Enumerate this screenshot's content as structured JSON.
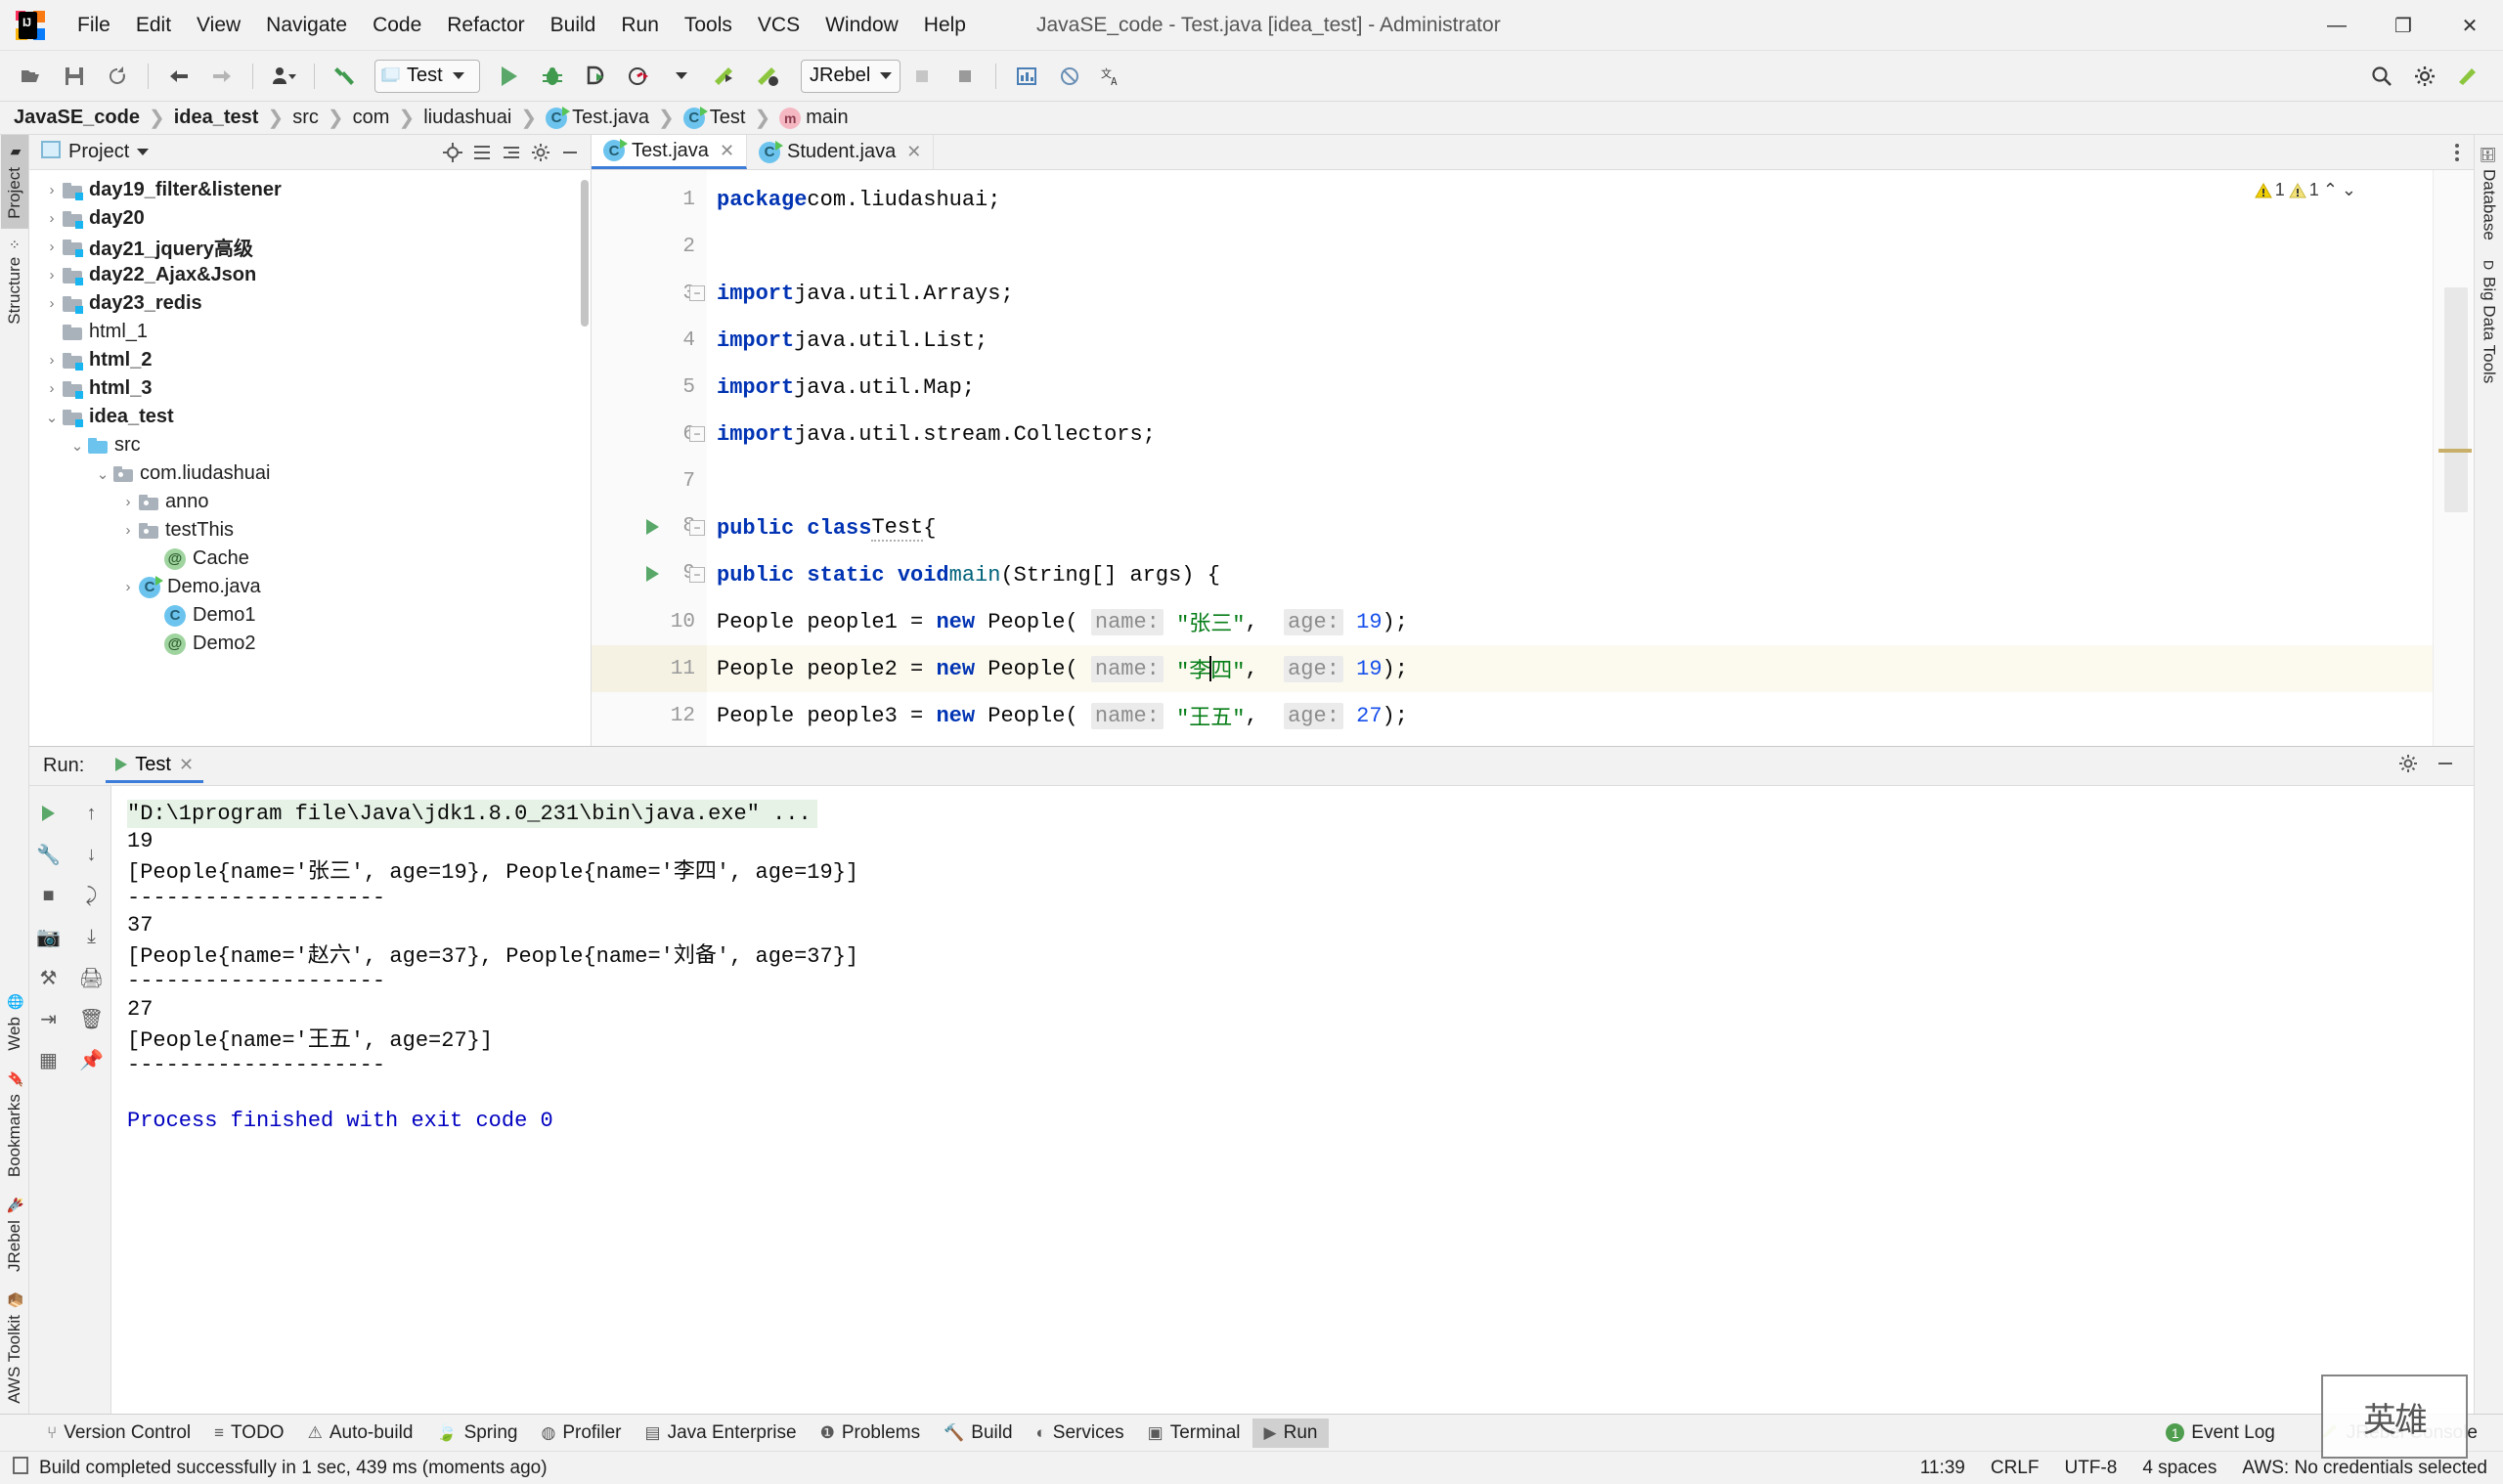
{
  "window": {
    "title": "JavaSE_code - Test.java [idea_test] - Administrator",
    "minimize": "—",
    "maximize": "❐",
    "close": "✕"
  },
  "menubar": {
    "items": [
      {
        "label": "File"
      },
      {
        "label": "Edit"
      },
      {
        "label": "View"
      },
      {
        "label": "Navigate"
      },
      {
        "label": "Code"
      },
      {
        "label": "Refactor"
      },
      {
        "label": "Build"
      },
      {
        "label": "Run"
      },
      {
        "label": "Tools"
      },
      {
        "label": "VCS"
      },
      {
        "label": "Window"
      },
      {
        "label": "Help"
      }
    ]
  },
  "toolbar": {
    "open_icon": "open-folder-icon",
    "save_icon": "save-icon",
    "sync_icon": "sync-icon",
    "back_icon": "back-arrow-icon",
    "forward_icon": "forward-arrow-icon",
    "profile_icon": "user-profile-icon",
    "build_icon": "hammer-icon",
    "run_config_name": "Test",
    "run_icon": "run-icon",
    "debug_icon": "debug-bug-icon",
    "run_coverage_icon": "run-with-coverage-icon",
    "profile_run_icon": "profiler-run-icon",
    "jrebel_run_icon": "jrebel-run-icon",
    "jrebel_debug_icon": "jrebel-debug-icon",
    "jrebel_label": "JRebel",
    "stop_icon": "stop-icon",
    "stop2_icon": "stop-square-icon",
    "chart_icon": "chart-icon",
    "forbidden_icon": "forbidden-icon",
    "translate_icon": "translate-icon",
    "search_icon": "search-icon",
    "settings_icon": "settings-gear-icon",
    "jrebel_toolbar_icon": "jrebel-rocket-icon"
  },
  "breadcrumb": {
    "items": [
      {
        "label": "JavaSE_code",
        "icon": "",
        "bold": true
      },
      {
        "label": "idea_test",
        "icon": "",
        "bold": true
      },
      {
        "label": "src",
        "icon": "",
        "bold": false
      },
      {
        "label": "com",
        "icon": "",
        "bold": false
      },
      {
        "label": "liudashuai",
        "icon": "",
        "bold": false
      },
      {
        "label": "Test.java",
        "icon": "class-icon",
        "bold": false
      },
      {
        "label": "Test",
        "icon": "class-icon",
        "bold": false
      },
      {
        "label": "main",
        "icon": "method-icon",
        "bold": false
      }
    ]
  },
  "left_rail": {
    "top": [
      {
        "label": "Project",
        "icon": "folder-icon",
        "active": true
      },
      {
        "label": "Structure",
        "icon": "structure-icon",
        "active": false
      }
    ],
    "bottom": [
      {
        "label": "Web",
        "icon": "web-globe-icon",
        "active": false
      },
      {
        "label": "Bookmarks",
        "icon": "bookmark-icon",
        "active": false
      },
      {
        "label": "JRebel",
        "icon": "jrebel-rocket-icon",
        "active": false
      },
      {
        "label": "AWS Toolkit",
        "icon": "aws-cube-icon",
        "active": false
      }
    ]
  },
  "right_rail": {
    "items": [
      {
        "label": "Database",
        "icon": "database-icon"
      },
      {
        "label": "Big Data Tools",
        "icon": "bigdata-icon"
      }
    ]
  },
  "project_panel": {
    "title": "Project",
    "dropdown_icon": "chevron-down-icon",
    "locate_icon": "locate-target-icon",
    "collapse_icon": "collapse-all-icon",
    "expand_icon": "expand-icon",
    "settings_icon": "gear-icon",
    "hide_icon": "minimize-icon",
    "tree": [
      {
        "label": "day19_filter&listener",
        "depth": 1,
        "arrow": "›",
        "icon": "module-folder-icon",
        "bold": true
      },
      {
        "label": "day20",
        "depth": 1,
        "arrow": "›",
        "icon": "module-folder-icon",
        "bold": true
      },
      {
        "label": "day21_jquery高级",
        "depth": 1,
        "arrow": "›",
        "icon": "module-folder-icon",
        "bold": true
      },
      {
        "label": "day22_Ajax&Json",
        "depth": 1,
        "arrow": "›",
        "icon": "module-folder-icon",
        "bold": true
      },
      {
        "label": "day23_redis",
        "depth": 1,
        "arrow": "›",
        "icon": "module-folder-icon",
        "bold": true
      },
      {
        "label": "html_1",
        "depth": 1,
        "arrow": "",
        "icon": "folder-icon",
        "bold": false
      },
      {
        "label": "html_2",
        "depth": 1,
        "arrow": "›",
        "icon": "module-folder-icon",
        "bold": true
      },
      {
        "label": "html_3",
        "depth": 1,
        "arrow": "›",
        "icon": "module-folder-icon",
        "bold": true
      },
      {
        "label": "idea_test",
        "depth": 1,
        "arrow": "⌄",
        "icon": "module-folder-icon",
        "bold": true
      },
      {
        "label": "src",
        "depth": 2,
        "arrow": "⌄",
        "icon": "source-folder-icon",
        "bold": false
      },
      {
        "label": "com.liudashuai",
        "depth": 3,
        "arrow": "⌄",
        "icon": "package-icon",
        "bold": false
      },
      {
        "label": "anno",
        "depth": 4,
        "arrow": "›",
        "icon": "package-icon",
        "bold": false
      },
      {
        "label": "testThis",
        "depth": 4,
        "arrow": "›",
        "icon": "package-icon",
        "bold": false
      },
      {
        "label": "Cache",
        "depth": 5,
        "arrow": "",
        "icon": "annotation-icon",
        "bold": false
      },
      {
        "label": "Demo.java",
        "depth": 4,
        "arrow": "›",
        "icon": "runnable-class-icon",
        "bold": false
      },
      {
        "label": "Demo1",
        "depth": 5,
        "arrow": "",
        "icon": "class-icon",
        "bold": false
      },
      {
        "label": "Demo2",
        "depth": 5,
        "arrow": "",
        "icon": "annotation-icon",
        "bold": false
      }
    ]
  },
  "editor": {
    "tabs": [
      {
        "label": "Test.java",
        "icon": "class-icon",
        "active": true,
        "close": "✕"
      },
      {
        "label": "Student.java",
        "icon": "class-icon",
        "active": false,
        "close": "✕"
      }
    ],
    "more_icon": "more-vertical-icon",
    "inspections": {
      "warning_count": "1",
      "weak_warning_count": "1",
      "up_icon": "chevron-up-icon",
      "down_icon": "chevron-down-icon"
    },
    "lines": [
      {
        "n": "1",
        "html": "<span class='kw'>package</span> <span class='plain'>com.liudashuai;</span>"
      },
      {
        "n": "2",
        "html": ""
      },
      {
        "n": "3",
        "html": "<span class='kw'>import</span> <span class='plain'>java.util.Arrays;</span>"
      },
      {
        "n": "4",
        "html": "<span class='kw'>import</span> <span class='plain'>java.util.List;</span>"
      },
      {
        "n": "5",
        "html": "<span class='kw'>import</span> <span class='plain'>java.util.Map;</span>"
      },
      {
        "n": "6",
        "html": "<span class='kw'>import</span> <span class='plain'>java.util.stream.Collectors;</span>"
      },
      {
        "n": "7",
        "html": ""
      },
      {
        "n": "8",
        "html": "<span class='kw'>public class</span> <span class='plain squiggle'>Test</span><span class='plain'>{</span>"
      },
      {
        "n": "9",
        "html": "    <span class='kw'>public static void</span> <span class='mth'>main</span><span class='plain'>(String[] args) {</span>"
      },
      {
        "n": "10",
        "html": "        <span class='plain'>People people1 = </span><span class='kw'>new</span><span class='plain'> People( </span><span class='hintp'>name:</span><span class='plain'> </span><span class='str'>\"张三\"</span><span class='plain'>,  </span><span class='hintp'>age:</span><span class='plain'> </span><span class='num'>19</span><span class='plain'>);</span>"
      },
      {
        "n": "11",
        "html": "        <span class='plain'>People people2 = </span><span class='kw'>new</span><span class='plain'> People( </span><span class='hintp'>name:</span><span class='plain'> </span><span class='str'>\"李</span><span class='caret'></span><span class='str'>四\"</span><span class='plain'>,  </span><span class='hintp'>age:</span><span class='plain'> </span><span class='num'>19</span><span class='plain'>);</span>"
      },
      {
        "n": "12",
        "html": "        <span class='plain'>People people3 = </span><span class='kw'>new</span><span class='plain'> People( </span><span class='hintp'>name:</span><span class='plain'> </span><span class='str'>\"王五\"</span><span class='plain'>,  </span><span class='hintp'>age:</span><span class='plain'> </span><span class='num'>27</span><span class='plain'>);</span>"
      }
    ]
  },
  "run_panel": {
    "label": "Run:",
    "tab_label": "Test",
    "tab_close": "✕",
    "settings_icon": "gear-icon",
    "hide_icon": "minimize-icon",
    "side_buttons": [
      "rerun-icon",
      "scroll-up-icon",
      "stop-icon",
      "soft-wrap-icon",
      "scroll-down-icon",
      "camera-icon",
      "filter-icon",
      "print-icon",
      "trash-icon"
    ],
    "console_lines": [
      {
        "text": "\"D:\\1program file\\Java\\jdk1.8.0_231\\bin\\java.exe\" ...",
        "style": "cmd"
      },
      {
        "text": "19",
        "style": "plain"
      },
      {
        "text": "[People{name='张三', age=19}, People{name='李四', age=19}]",
        "style": "plain"
      },
      {
        "text": "--------------------",
        "style": "plain"
      },
      {
        "text": "37",
        "style": "plain"
      },
      {
        "text": "[People{name='赵六', age=37}, People{name='刘备', age=37}]",
        "style": "plain"
      },
      {
        "text": "--------------------",
        "style": "plain"
      },
      {
        "text": "27",
        "style": "plain"
      },
      {
        "text": "[People{name='王五', age=27}]",
        "style": "plain"
      },
      {
        "text": "--------------------",
        "style": "plain"
      },
      {
        "text": "",
        "style": "plain"
      },
      {
        "text": "Process finished with exit code 0",
        "style": "exit"
      }
    ]
  },
  "toolwindow_bar": {
    "items": [
      {
        "label": "Version Control",
        "icon": "branch-icon",
        "active": false
      },
      {
        "label": "TODO",
        "icon": "list-icon",
        "active": false
      },
      {
        "label": "Auto-build",
        "icon": "warning-triangle-icon",
        "active": false
      },
      {
        "label": "Spring",
        "icon": "spring-leaf-icon",
        "active": false
      },
      {
        "label": "Profiler",
        "icon": "profiler-icon",
        "active": false
      },
      {
        "label": "Java Enterprise",
        "icon": "java-ee-icon",
        "active": false
      },
      {
        "label": "Problems",
        "icon": "problems-icon",
        "active": false
      },
      {
        "label": "Build",
        "icon": "hammer-icon",
        "active": false
      },
      {
        "label": "Services",
        "icon": "services-icon",
        "active": false
      },
      {
        "label": "Terminal",
        "icon": "terminal-icon",
        "active": false
      },
      {
        "label": "Run",
        "icon": "run-icon",
        "active": true
      }
    ],
    "right": [
      {
        "label": "Event Log",
        "icon": "event-log-badge",
        "badge": "1"
      },
      {
        "label": "JRebel Console",
        "icon": "jrebel-rocket-icon",
        "badge": ""
      }
    ]
  },
  "statusbar": {
    "message_icon": "message-icon",
    "message": "Build completed successfully in 1 sec, 439 ms (moments ago)",
    "right": [
      {
        "label": "11:39"
      },
      {
        "label": "CRLF"
      },
      {
        "label": "UTF-8"
      },
      {
        "label": "4 spaces"
      },
      {
        "label": "AWS: No credentials selected"
      }
    ]
  },
  "watermark": {
    "text": "英雄"
  },
  "colors": {
    "accent_blue": "#3b7dd8",
    "keyword_blue": "#0033b3",
    "string_green": "#067d17",
    "number_blue": "#1750eb",
    "method_teal": "#00627a",
    "run_green": "#59a869",
    "console_cmd_bg": "#e6f2e6",
    "highlight_line": "#fcfaef",
    "chrome_bg": "#f2f2f2"
  }
}
